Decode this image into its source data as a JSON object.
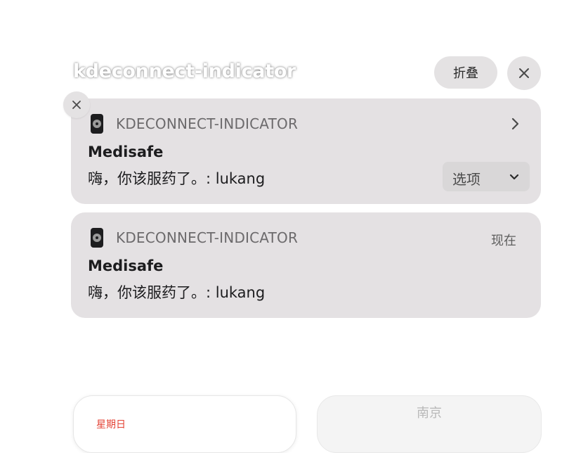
{
  "group": {
    "title": "kdeconnect-indicator",
    "collapse_label": "折叠",
    "close_icon": "close-icon"
  },
  "notifications": [
    {
      "app_name": "KDECONNECT-INDICATOR",
      "title": "Medisafe",
      "body": "嗨，你该服药了。: lukang",
      "options_label": "选项",
      "icon": "kdeconnect-app-icon",
      "trailing_icon": "chevron-right-icon"
    },
    {
      "app_name": "KDECONNECT-INDICATOR",
      "title": "Medisafe",
      "body": "嗨，你该服药了。: lukang",
      "time": "现在",
      "icon": "kdeconnect-app-icon"
    }
  ],
  "widgets": {
    "left_text": "星期日",
    "right_text": "南京"
  },
  "colors": {
    "card_background": "#e4e1e3",
    "button_background": "#e4e2e3",
    "calendar_accent": "#e34234"
  }
}
